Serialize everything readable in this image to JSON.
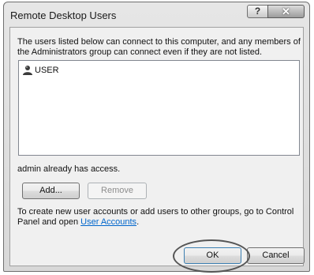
{
  "window": {
    "title": "Remote Desktop Users",
    "help_label": "?",
    "close_label": "✕"
  },
  "dialog": {
    "description": "The users listed below can connect to this computer, and any members of the Administrators group can connect even if they are not listed.",
    "users": [
      {
        "name": "USER",
        "icon": "user-icon"
      }
    ],
    "access_text": "admin already has access.",
    "add_label": "Add...",
    "remove_label": "Remove",
    "info_text_before": "To create new user accounts or add users to other groups, go to Control Panel and open ",
    "info_link": "User Accounts",
    "info_text_after": ".",
    "ok_label": "OK",
    "cancel_label": "Cancel"
  },
  "colors": {
    "link": "#0066cc",
    "dialog_bg": "#f0f0f0"
  }
}
